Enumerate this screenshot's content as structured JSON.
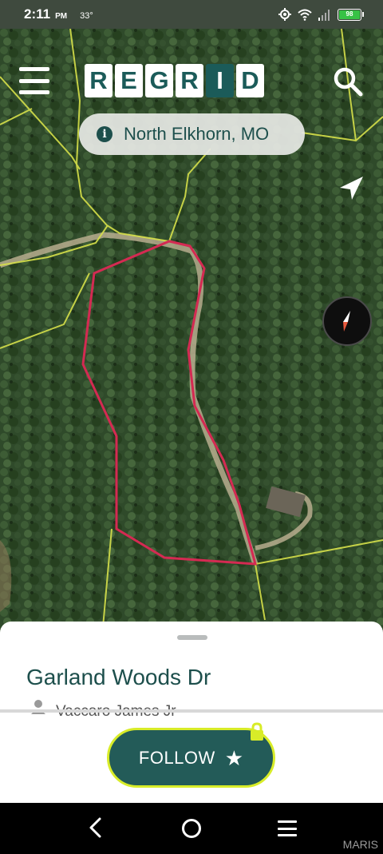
{
  "status_bar": {
    "time": "2:11",
    "ampm": "PM",
    "temperature": "33°",
    "battery_level": "98",
    "battery_color": "#37c245",
    "icons": [
      "location-target-icon",
      "wifi-icon",
      "signal-bars-icon",
      "battery-icon"
    ]
  },
  "header": {
    "menu_icon": "hamburger-menu-icon",
    "logo_letters": [
      "R",
      "E",
      "G",
      "R",
      "I",
      "D"
    ],
    "search_icon": "search-icon",
    "brand_color": "#1b5b59"
  },
  "location": {
    "info_glyph": "i",
    "name": "North Elkhorn, MO"
  },
  "map": {
    "locate_icon": "navigation-arrow-icon",
    "compass_icon": "compass-icon",
    "parcel_outline_color": "#d42a52",
    "boundary_line_color": "#d6e04a"
  },
  "parcel": {
    "address": "Garland Woods Dr",
    "owner": "Vaccaro James Jr"
  },
  "actions": {
    "follow_label": "FOLLOW",
    "star_glyph": "★",
    "accent_color": "#d8ec28"
  },
  "nav_bar": {
    "icons": [
      "back-icon",
      "home-icon",
      "recents-icon"
    ]
  },
  "watermark": "MARIS"
}
